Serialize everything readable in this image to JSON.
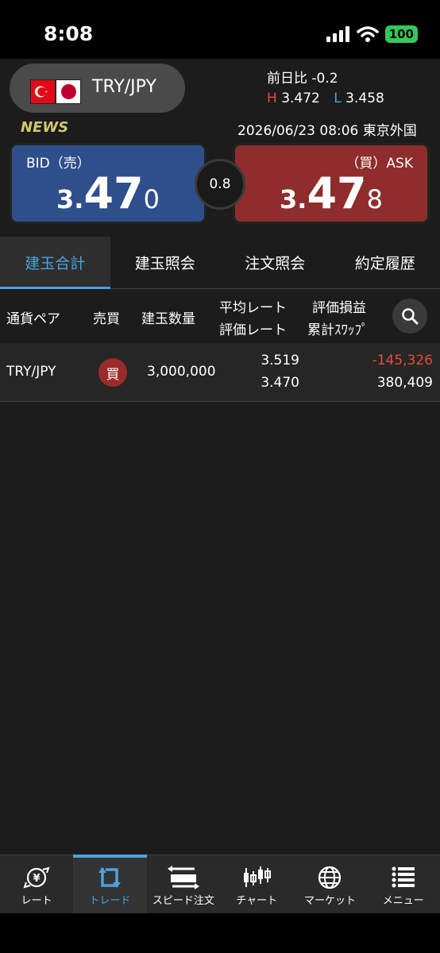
{
  "status": {
    "time": "8:08",
    "battery": "100"
  },
  "header": {
    "pair": "TRY/JPY",
    "change_label": "前日比",
    "change_value": "-0.2",
    "high_label": "H",
    "high_value": "3.472",
    "low_label": "L",
    "low_value": "3.458",
    "news_label": "NEWS",
    "timestamp": "2026/06/23 08:06 東京外国",
    "bid_label": "BID（売）",
    "bid_price": {
      "head": "3.",
      "big": "47",
      "tail": "0"
    },
    "ask_label": "（買）ASK",
    "ask_price": {
      "head": "3.",
      "big": "47",
      "tail": "8"
    },
    "spread": "0.8"
  },
  "tabs": [
    {
      "label": "建玉合計",
      "active": true
    },
    {
      "label": "建玉照会",
      "active": false
    },
    {
      "label": "注文照会",
      "active": false
    },
    {
      "label": "約定履歴",
      "active": false
    }
  ],
  "table": {
    "headers": {
      "pair": "通貨ペア",
      "side": "売買",
      "quantity": "建玉数量",
      "avg_rate": "平均レート",
      "eval_rate": "評価レート",
      "pnl": "評価損益",
      "swap": "累計ｽﾜｯﾌﾟ"
    },
    "rows": [
      {
        "pair": "TRY/JPY",
        "side": "買",
        "quantity": "3,000,000",
        "avg_rate": "3.519",
        "eval_rate": "3.470",
        "pnl": "-145,326",
        "swap": "380,409"
      }
    ]
  },
  "nav": [
    {
      "label": "レート",
      "icon": "rate-icon"
    },
    {
      "label": "トレード",
      "icon": "trade-icon",
      "active": true
    },
    {
      "label": "スピード注文",
      "icon": "speed-order-icon"
    },
    {
      "label": "チャート",
      "icon": "chart-icon"
    },
    {
      "label": "マーケット",
      "icon": "globe-icon"
    },
    {
      "label": "メニュー",
      "icon": "menu-icon"
    }
  ],
  "colors": {
    "accent": "#4aa3df",
    "bid": "#2f4f8c",
    "ask": "#8f2d2d",
    "negative": "#e84a3c",
    "news": "#d4c76e"
  }
}
